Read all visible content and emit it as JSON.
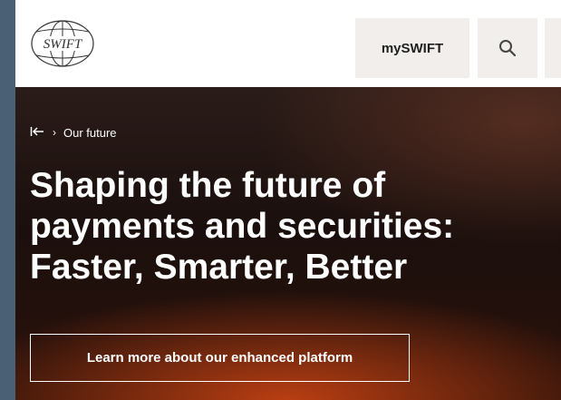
{
  "header": {
    "logo_text": "SWIFT",
    "myswift_label": "mySWIFT",
    "search_icon": "search-icon",
    "menu_icon": "menu-icon"
  },
  "hero": {
    "breadcrumb": {
      "back_icon": "back-to-start-icon",
      "separator": "›",
      "current": "Our future"
    },
    "title_lines": [
      "Shaping the future of",
      "payments and securities:",
      "Faster, Smarter, Better"
    ],
    "cta_label": "Learn more about our enhanced platform"
  },
  "colors": {
    "page_bg": "#4a6075",
    "header_bg": "#ffffff",
    "button_bg": "#f1eeec",
    "hero_dark": "#1a0f0d",
    "hero_glow": "#d2461a",
    "text_light": "#ffffff"
  }
}
